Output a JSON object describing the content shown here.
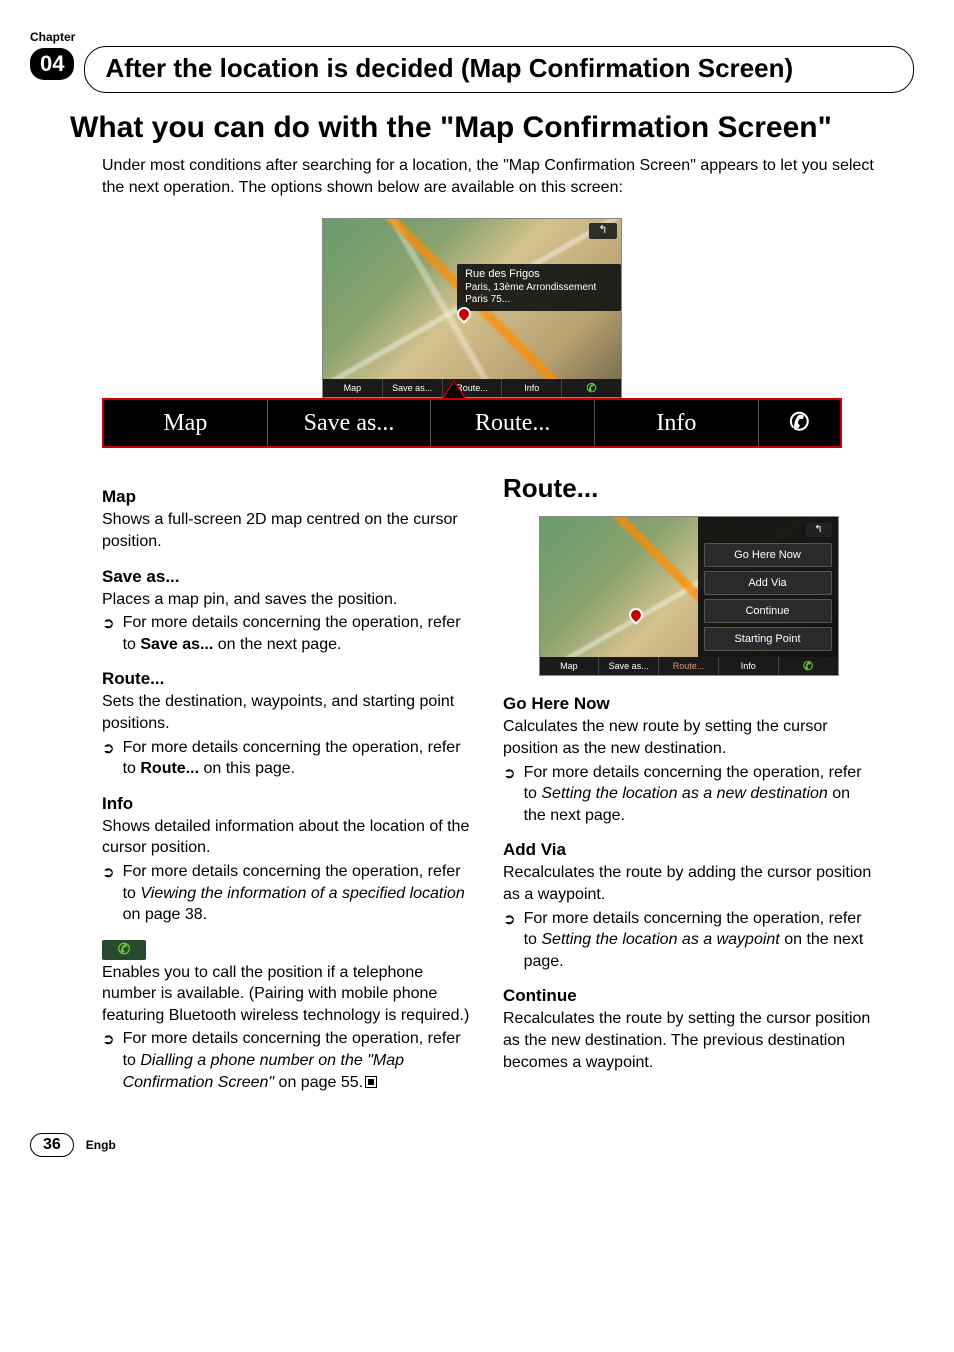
{
  "chapter": {
    "label": "Chapter",
    "number": "04",
    "title": "After the location is decided (Map Confirmation Screen)"
  },
  "heading": "What you can do with the \"Map Confirmation Screen\"",
  "intro": "Under most conditions after searching for a location, the \"Map Confirmation Screen\" appears to let you select the next operation. The options shown below are available on this screen:",
  "screenshot1": {
    "address_line1": "Rue des Frigos",
    "address_line2": "Paris, 13ème Arrondissement Paris 75...",
    "back": "↰",
    "toolbar": {
      "map": "Map",
      "saveas": "Save as...",
      "route": "Route...",
      "info": "Info",
      "phone": "✆"
    }
  },
  "toolbar_large": {
    "map": "Map",
    "saveas": "Save as...",
    "route": "Route...",
    "info": "Info",
    "phone": "✆"
  },
  "left": {
    "map": {
      "title": "Map",
      "text": "Shows a full-screen 2D map centred on the cursor position."
    },
    "saveas": {
      "title": "Save as...",
      "text": "Places a map pin, and saves the position.",
      "bullet_pre": "For more details concerning the operation, refer to ",
      "bullet_bold": "Save as...",
      "bullet_post": " on the next page."
    },
    "route": {
      "title": "Route...",
      "text": "Sets the destination, waypoints, and starting point positions.",
      "bullet_pre": "For more details concerning the operation, refer to ",
      "bullet_bold": "Route...",
      "bullet_post": " on this page."
    },
    "info": {
      "title": "Info",
      "text": "Shows detailed information about the location of the cursor position.",
      "bullet_pre": "For more details concerning the operation, refer to ",
      "bullet_italic": "Viewing the information of a specified location",
      "bullet_post": " on page 38."
    },
    "phone": {
      "text": "Enables you to call the position if a telephone number is available. (Pairing with mobile phone featuring Bluetooth wireless technology is required.)",
      "bullet_pre": "For more details concerning the operation, refer to ",
      "bullet_italic": "Dialling a phone number on the \"Map Confirmation Screen\"",
      "bullet_post": " on page 55."
    }
  },
  "right": {
    "heading": "Route...",
    "screenshot": {
      "back": "↰",
      "menu": {
        "go": "Go Here Now",
        "add": "Add Via",
        "cont": "Continue",
        "start": "Starting Point"
      },
      "toolbar": {
        "map": "Map",
        "saveas": "Save as...",
        "route": "Route...",
        "info": "Info",
        "phone": "✆"
      }
    },
    "go": {
      "title": "Go Here Now",
      "text": "Calculates the new route by setting the cursor position as the new destination.",
      "bullet_pre": "For more details concerning the operation, refer to ",
      "bullet_italic": "Setting the location as a new destination",
      "bullet_post": " on the next page."
    },
    "add": {
      "title": "Add Via",
      "text": "Recalculates the route by adding the cursor position as a waypoint.",
      "bullet_pre": "For more details concerning the operation, refer to ",
      "bullet_italic": "Setting the location as a waypoint",
      "bullet_post": " on the next page."
    },
    "cont": {
      "title": "Continue",
      "text": "Recalculates the route by setting the cursor position as the new destination. The previous destination becomes a waypoint."
    }
  },
  "footer": {
    "page": "36",
    "lang": "Engb"
  }
}
